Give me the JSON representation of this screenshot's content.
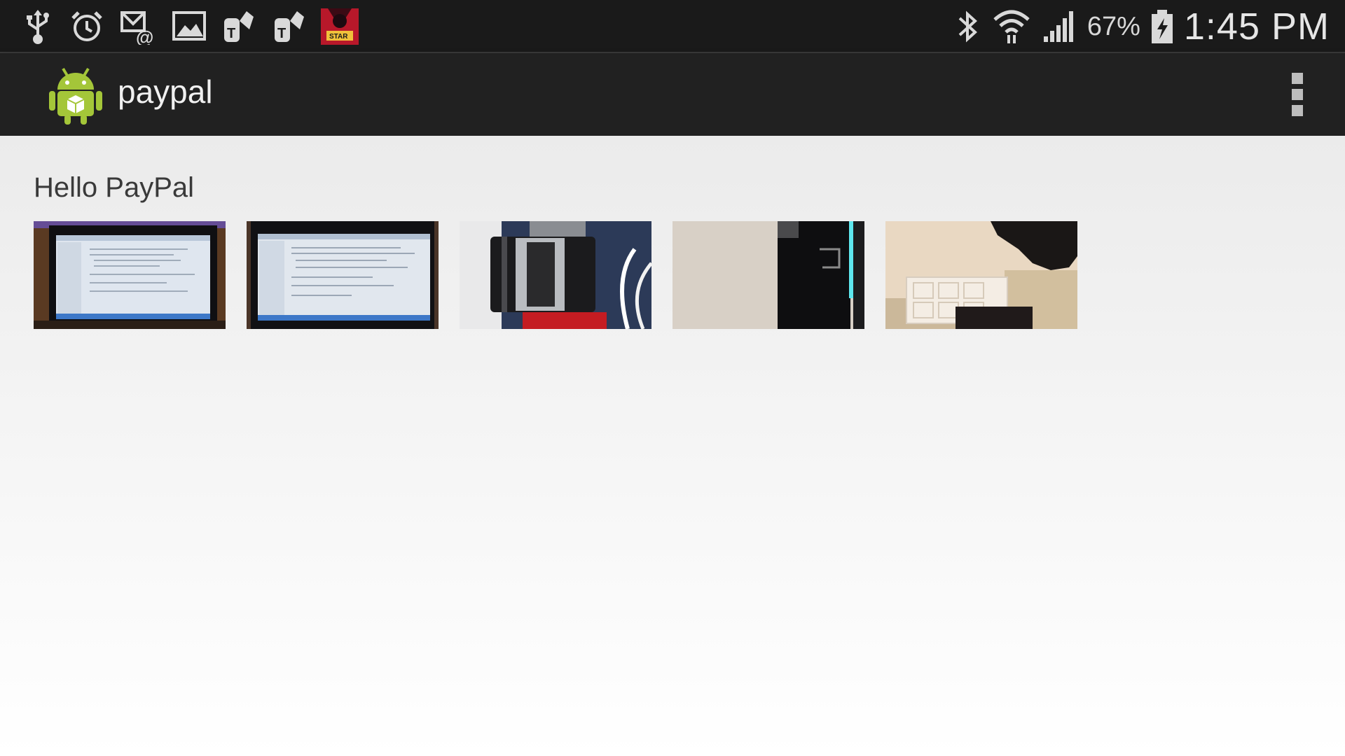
{
  "status_bar": {
    "battery_percent": "67%",
    "time": "1:45 PM",
    "notification_icons": [
      "usb-icon",
      "alarm-icon",
      "email-icon",
      "gallery-icon",
      "tmobile-icon",
      "tmobile-icon",
      "star-wars-app-icon"
    ],
    "system_icons": [
      "bluetooth-icon",
      "wifi-icon",
      "signal-icon",
      "battery-charging-icon"
    ]
  },
  "action_bar": {
    "title": "paypal",
    "app_icon": "android-robot-icon",
    "overflow_icon": "overflow-menu-icon"
  },
  "main": {
    "greeting": "Hello PayPal",
    "thumbnails": [
      {
        "subject": "laptop screen with code"
      },
      {
        "subject": "laptop screen with code"
      },
      {
        "subject": "travel mug"
      },
      {
        "subject": "wall and dark object"
      },
      {
        "subject": "room with door"
      }
    ]
  }
}
